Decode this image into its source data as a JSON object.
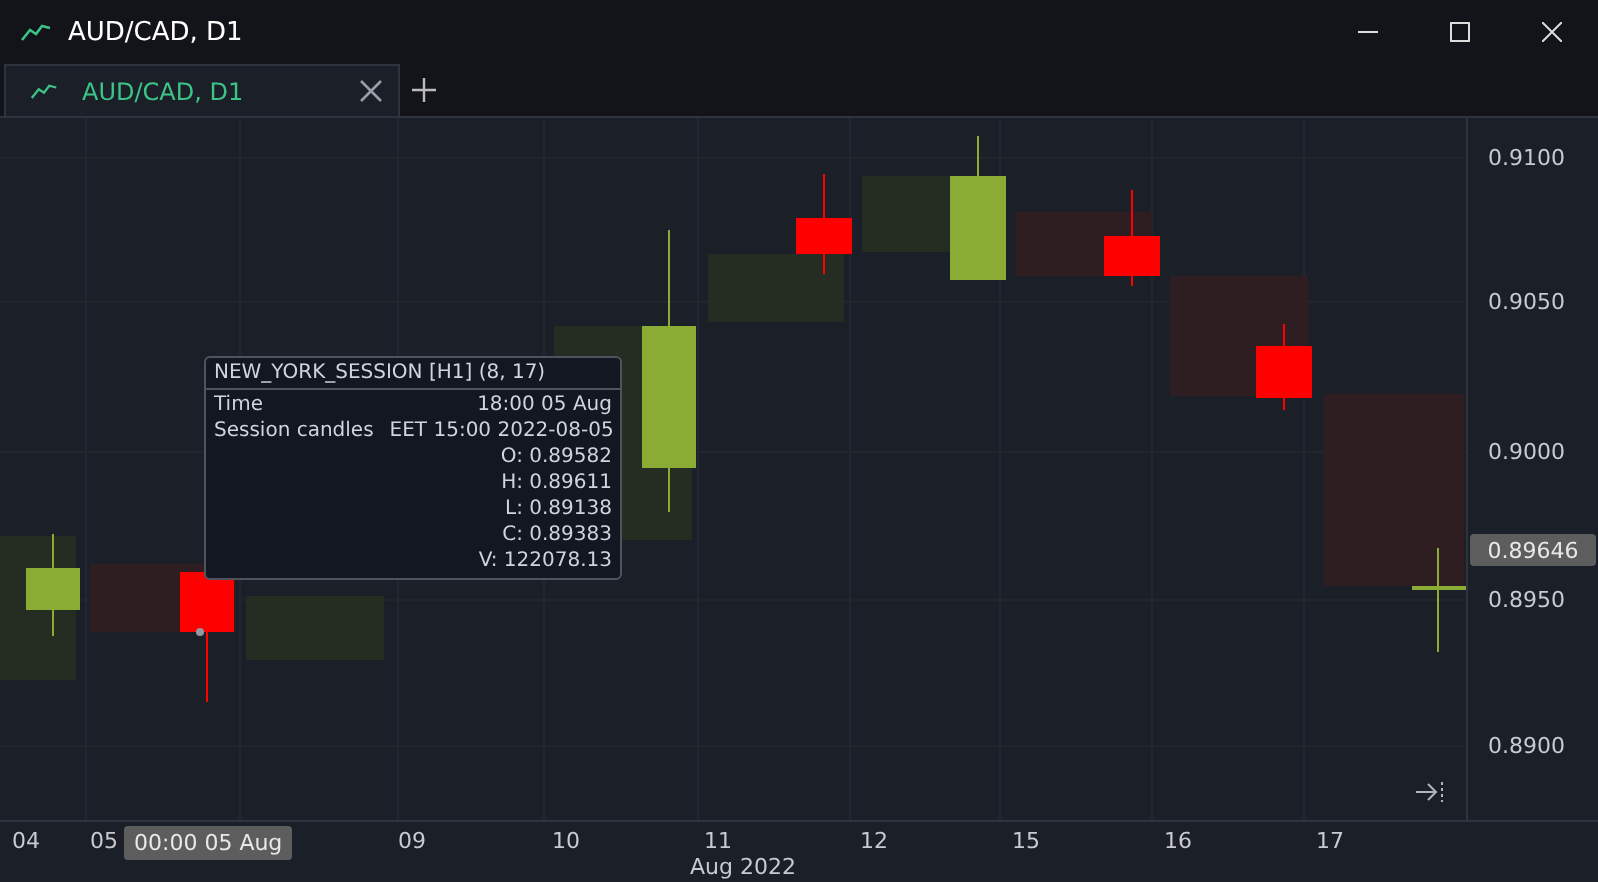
{
  "window": {
    "title": "AUD/CAD, D1"
  },
  "tabs": [
    {
      "label": "AUD/CAD, D1",
      "selected": true
    }
  ],
  "price_axis": {
    "labels": [
      "0.9100",
      "0.9050",
      "0.9000",
      "0.8950",
      "0.8900"
    ],
    "current_price": "0.89646"
  },
  "time_axis": {
    "labels": [
      "04",
      "05",
      "09",
      "10",
      "11",
      "12",
      "15",
      "16",
      "17"
    ],
    "crosshair_label": "00:00 05 Aug",
    "month_label": "Aug 2022"
  },
  "tooltip": {
    "title": "NEW_YORK_SESSION [H1] (8, 17)",
    "rows": [
      {
        "label": "Time",
        "value": "18:00 05 Aug"
      },
      {
        "label": "Session candles",
        "value": "EET 15:00 2022-08-05"
      },
      {
        "value": "O: 0.89582"
      },
      {
        "value": "H: 0.89611"
      },
      {
        "value": "L: 0.89138"
      },
      {
        "value": "C: 0.89383"
      },
      {
        "value": "V: 122078.13"
      }
    ]
  }
}
